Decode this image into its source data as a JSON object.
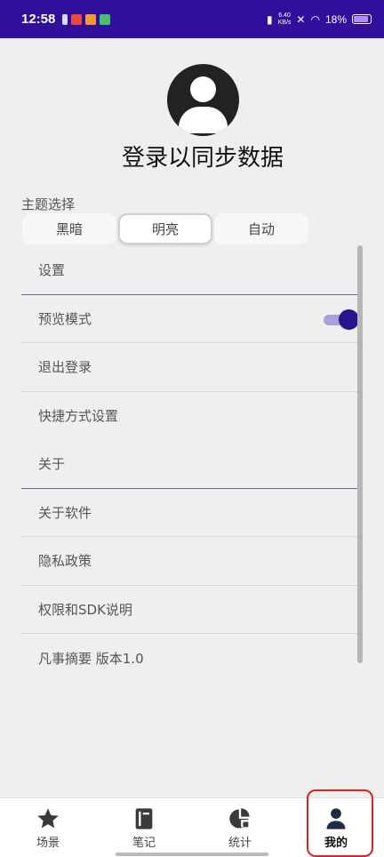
{
  "status_bar": {
    "time": "12:58",
    "net_speed_value": "6.40",
    "net_speed_unit": "KB/s",
    "battery": "18%"
  },
  "profile": {
    "login_title": "登录以同步数据"
  },
  "theme": {
    "label": "主题选择",
    "options": [
      "黑暗",
      "明亮",
      "自动"
    ],
    "selected": "明亮"
  },
  "settings": {
    "items": [
      {
        "label": "设置"
      },
      {
        "label": "预览模式",
        "toggle": true
      },
      {
        "label": "退出登录"
      },
      {
        "label": "快捷方式设置"
      },
      {
        "label": "关于"
      },
      {
        "label": "关于软件"
      },
      {
        "label": "隐私政策"
      },
      {
        "label": "权限和SDK说明"
      },
      {
        "label": "凡事摘要 版本1.0"
      }
    ]
  },
  "nav": {
    "items": [
      {
        "label": "场景",
        "icon": "star-icon"
      },
      {
        "label": "笔记",
        "icon": "notebook-icon"
      },
      {
        "label": "统计",
        "icon": "chart-icon"
      },
      {
        "label": "我的",
        "icon": "person-icon"
      }
    ],
    "active": "我的"
  },
  "colors": {
    "status_bar": "#2f0f9c",
    "accent": "#2a1590",
    "highlight_box": "#e02020"
  }
}
